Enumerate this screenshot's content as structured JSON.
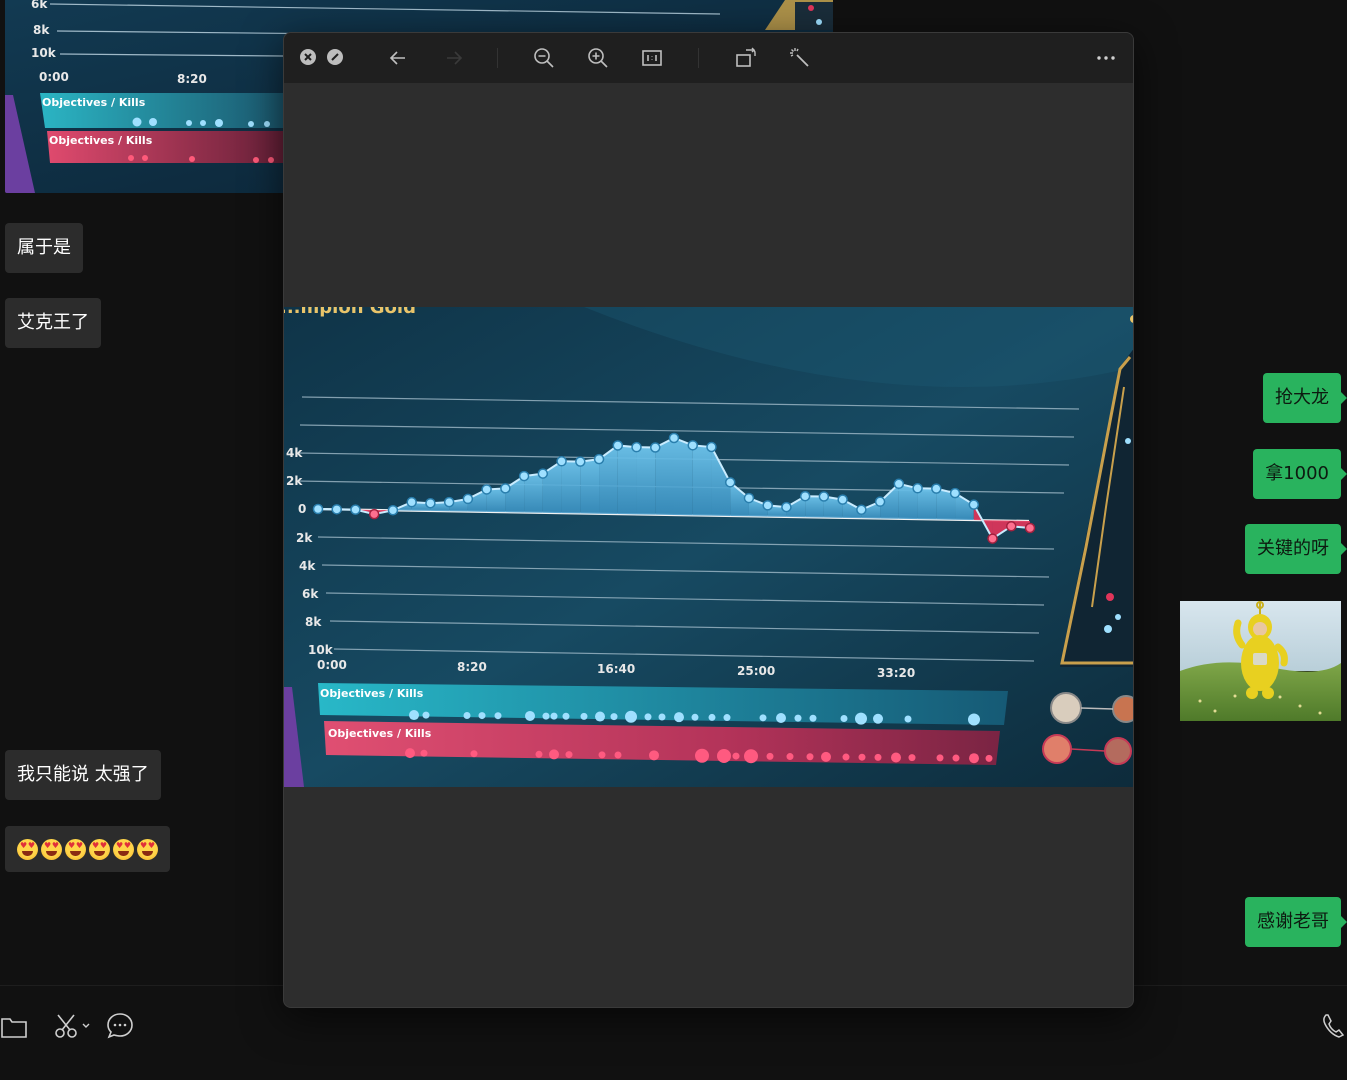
{
  "chat": {
    "messages_left": [
      {
        "text": "属于是"
      },
      {
        "text": "艾克王了"
      },
      {
        "text": "我只能说 太强了"
      }
    ],
    "emoji_message": {
      "emoji": "star-struck-face",
      "count": 6
    },
    "messages_right": [
      {
        "text": "抢大龙"
      },
      {
        "text": "拿1000"
      },
      {
        "text": "关键的呀"
      },
      {
        "text": "感谢老哥"
      }
    ]
  },
  "thumbnail": {
    "ticks_y": [
      "6k",
      "8k",
      "10k"
    ],
    "ticks_x": [
      "0:00",
      "8:20"
    ],
    "band_top": "Objectives / Kills",
    "band_bottom": "Objectives / Kills"
  },
  "viewer": {
    "toolbar": {
      "close": "close-icon",
      "minimize": "minimize-icon",
      "back": "arrow-left-icon",
      "forward": "arrow-right-icon",
      "zoom_out": "zoom-out-icon",
      "zoom_in": "zoom-in-icon",
      "actual_size": "actual-size-icon",
      "rotate": "rotate-icon",
      "edit": "magic-wand-icon",
      "more": "more-icon"
    },
    "photo": {
      "partial_title": "...mpion Gold",
      "band_top": "Objectives / Kills",
      "band_bottom": "Objectives / Kills"
    }
  },
  "chart_data": {
    "type": "area",
    "title": "",
    "x_ticks": [
      "0:00",
      "8:20",
      "16:40",
      "25:00",
      "33:20"
    ],
    "y_ticks_above": [
      "2k",
      "4k"
    ],
    "y_ticks_below": [
      "2k",
      "4k",
      "6k",
      "8k",
      "10k"
    ],
    "zero_label": "0",
    "xlabel": "",
    "ylabel": "",
    "ylim": [
      -10000,
      8000
    ],
    "series": [
      {
        "values": [
          0,
          0,
          0,
          -300,
          0,
          600,
          550,
          650,
          900,
          1600,
          1700,
          2600,
          2800,
          3700,
          3700,
          3900,
          4900,
          4800,
          4800,
          5500,
          5000,
          4900,
          2400,
          1300,
          800,
          700,
          1500,
          1500,
          1300,
          600,
          1200,
          2500,
          2200,
          2200,
          1900,
          1100,
          -1300,
          -400,
          -500
        ]
      }
    ],
    "colors": {
      "positive": "#59b8e6",
      "negative": "#e0355a",
      "points": "#9fe0ff"
    },
    "grid": true
  },
  "colors": {
    "accent_green": "#29b35e",
    "bubble_gray": "#2c2c2c",
    "background": "#111111",
    "viewer_bg": "#2d2d2d"
  },
  "bottom_toolbar": {
    "folder": "folder-icon",
    "scissors": "scissors-icon",
    "chat": "chat-bubble-icon",
    "phone": "phone-icon"
  }
}
